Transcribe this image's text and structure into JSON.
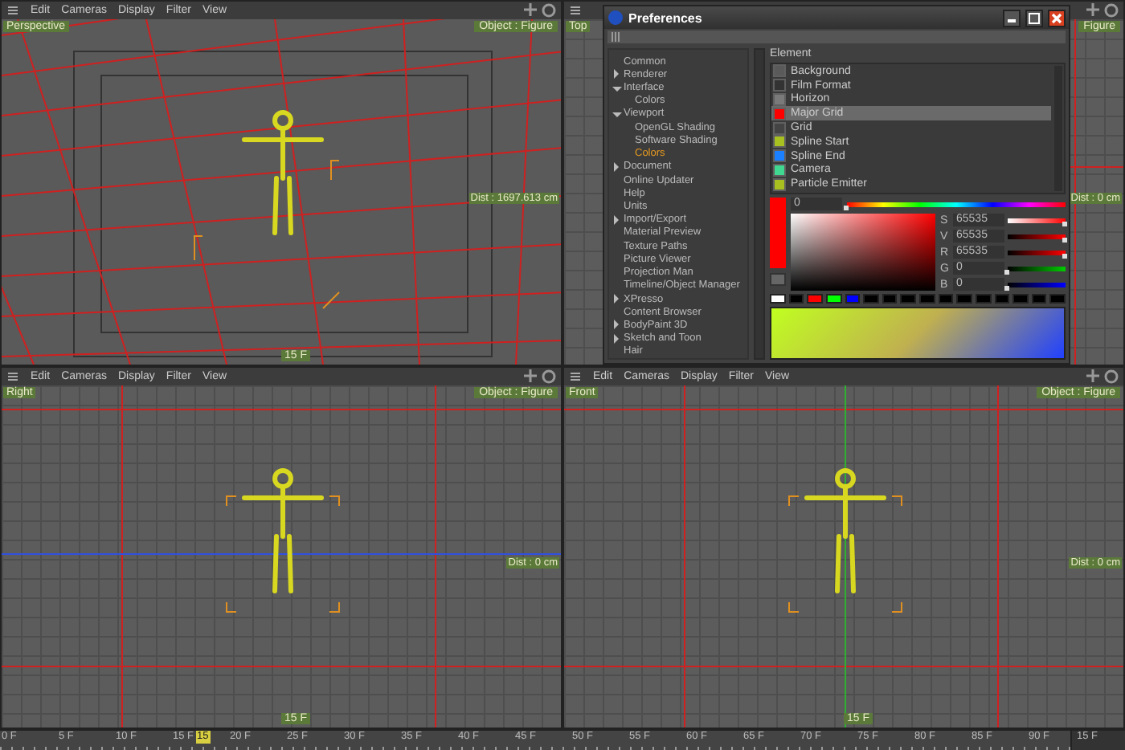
{
  "viewports": [
    {
      "kind": "perspective",
      "label": "Perspective",
      "menu": [
        "Edit",
        "Cameras",
        "Display",
        "Filter",
        "View"
      ],
      "badge": "Object : Figure",
      "dist": "Dist : 1697.613 cm",
      "frame": "15 F"
    },
    {
      "kind": "top",
      "label": "Top",
      "badge": "Figure",
      "dist": "Dist : 0 cm"
    },
    {
      "kind": "right",
      "label": "Right",
      "menu": [
        "Edit",
        "Cameras",
        "Display",
        "Filter",
        "View"
      ],
      "badge": "Object : Figure",
      "dist": "Dist : 0 cm",
      "frame": "15 F"
    },
    {
      "kind": "front",
      "label": "Front",
      "menu": [
        "Edit",
        "Cameras",
        "Display",
        "Filter",
        "View"
      ],
      "badge": "Object : Figure",
      "dist": "Dist : 0 cm",
      "frame": "15 F"
    }
  ],
  "timeline": {
    "ticks": [
      "0 F",
      "5 F",
      "10 F",
      "15 F",
      "20 F",
      "25 F",
      "30 F",
      "35 F",
      "40 F",
      "45 F",
      "50 F",
      "55 F",
      "60 F",
      "65 F",
      "70 F",
      "75 F",
      "80 F",
      "85 F",
      "90 F"
    ],
    "marker": "15",
    "field": "15 F"
  },
  "preferences": {
    "title": "Preferences",
    "tree": [
      {
        "label": "Common",
        "kind": "page",
        "selected": false
      },
      {
        "label": "Renderer",
        "kind": "group",
        "expanded": false,
        "selected": false
      },
      {
        "label": "Interface",
        "kind": "group",
        "expanded": true,
        "selected": false,
        "children": [
          {
            "label": "Colors",
            "kind": "page",
            "selected": false
          }
        ]
      },
      {
        "label": "Viewport",
        "kind": "group",
        "expanded": true,
        "selected": false,
        "children": [
          {
            "label": "OpenGL Shading",
            "kind": "page",
            "selected": false
          },
          {
            "label": "Software Shading",
            "kind": "page",
            "selected": false
          },
          {
            "label": "Colors",
            "kind": "page",
            "selected": true
          }
        ]
      },
      {
        "label": "Document",
        "kind": "group",
        "expanded": false,
        "selected": false
      },
      {
        "label": "Online Updater",
        "kind": "page",
        "selected": false
      },
      {
        "label": "Help",
        "kind": "page",
        "selected": false
      },
      {
        "label": "Units",
        "kind": "page",
        "selected": false
      },
      {
        "label": "Import/Export",
        "kind": "group",
        "expanded": false,
        "selected": false
      },
      {
        "label": "Material Preview",
        "kind": "page",
        "selected": false
      },
      {
        "label": "Texture Paths",
        "kind": "page",
        "selected": false
      },
      {
        "label": "Picture Viewer",
        "kind": "page",
        "selected": false
      },
      {
        "label": "Projection Man",
        "kind": "page",
        "selected": false
      },
      {
        "label": "Timeline/Object Manager",
        "kind": "page",
        "selected": false
      },
      {
        "label": "XPresso",
        "kind": "group",
        "expanded": false,
        "selected": false
      },
      {
        "label": "Content Browser",
        "kind": "page",
        "selected": false
      },
      {
        "label": "BodyPaint 3D",
        "kind": "group",
        "expanded": false,
        "selected": false
      },
      {
        "label": "Sketch and Toon",
        "kind": "group",
        "expanded": false,
        "selected": false
      },
      {
        "label": "Hair",
        "kind": "page",
        "selected": false
      }
    ],
    "element_header": "Element",
    "elements": [
      {
        "label": "Background",
        "color": "#5a5a5a",
        "selected": false
      },
      {
        "label": "Film Format",
        "color": "#333333",
        "selected": false
      },
      {
        "label": "Horizon",
        "color": "#7a7a7a",
        "selected": false
      },
      {
        "label": "Major Grid",
        "color": "#ff0000",
        "selected": true
      },
      {
        "label": "Grid",
        "color": "#444444",
        "selected": false
      },
      {
        "label": "Spline Start",
        "color": "#a8c020",
        "selected": false
      },
      {
        "label": "Spline End",
        "color": "#1a80ff",
        "selected": false
      },
      {
        "label": "Camera",
        "color": "#40d890",
        "selected": false
      },
      {
        "label": "Particle Emitter",
        "color": "#a8c020",
        "selected": false
      }
    ],
    "hue": {
      "value": "0",
      "level": 0
    },
    "channels": [
      {
        "name": "S",
        "value": "65535",
        "level": 1,
        "kind": "sat"
      },
      {
        "name": "V",
        "value": "65535",
        "level": 1,
        "kind": "val"
      },
      {
        "name": "R",
        "value": "65535",
        "level": 1,
        "kind": "red"
      },
      {
        "name": "G",
        "value": "0",
        "level": 0,
        "kind": "green"
      },
      {
        "name": "B",
        "value": "0",
        "level": 0,
        "kind": "blue"
      }
    ],
    "swatches": [
      {
        "color": "#ffffff"
      },
      {
        "color": "#000000"
      },
      {
        "color": "#ff0000"
      },
      {
        "color": "#00ff00"
      },
      {
        "color": "#0000ff"
      },
      {
        "color": "#000000"
      },
      {
        "color": "#000000"
      },
      {
        "color": "#000000"
      },
      {
        "color": "#000000"
      },
      {
        "color": "#000000"
      },
      {
        "color": "#000000"
      },
      {
        "color": "#000000"
      },
      {
        "color": "#000000"
      },
      {
        "color": "#000000"
      },
      {
        "color": "#000000"
      },
      {
        "color": "#000000"
      }
    ]
  }
}
